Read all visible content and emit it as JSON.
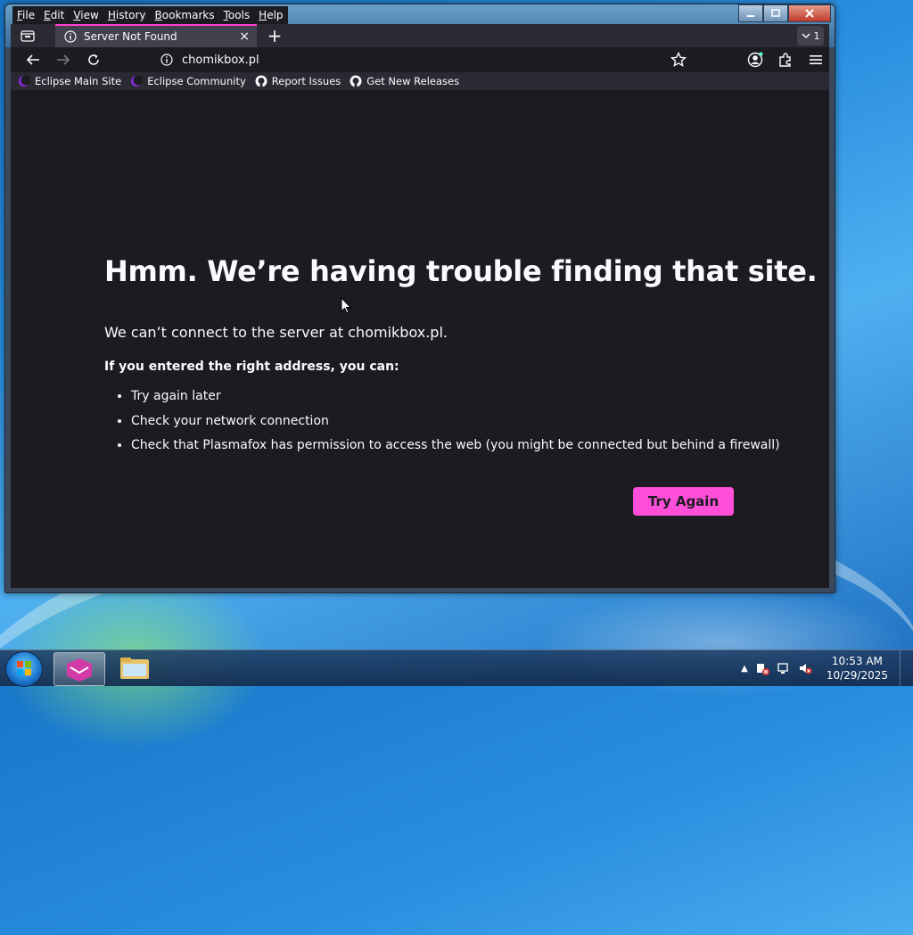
{
  "menu": {
    "items": [
      "File",
      "Edit",
      "View",
      "History",
      "Bookmarks",
      "Tools",
      "Help"
    ]
  },
  "tab": {
    "title": "Server Not Found",
    "close": "×",
    "count": "1"
  },
  "newtab_label": "+",
  "urlbar": {
    "url": "chomikbox.pl"
  },
  "bookmarks": [
    {
      "label": "Eclipse Main Site",
      "icon": "eclipse-icon"
    },
    {
      "label": "Eclipse Community",
      "icon": "eclipse-icon"
    },
    {
      "label": "Report Issues",
      "icon": "github-icon"
    },
    {
      "label": "Get New Releases",
      "icon": "github-icon"
    }
  ],
  "error": {
    "title": "Hmm. We’re having trouble finding that site.",
    "subtitle": "We can’t connect to the server at chomikbox.pl.",
    "lead": "If you entered the right address, you can:",
    "items": [
      "Try again later",
      "Check your network connection",
      "Check that Plasmafox has permission to access the web (you might be connected but behind a firewall)"
    ],
    "button": "Try Again"
  },
  "taskbar": {
    "time": "10:53 AM",
    "date": "10/29/2025"
  },
  "colors": {
    "accent": "#ff4fd8",
    "page_bg": "#1c1b22",
    "toolbar_bg": "#2b2a33"
  }
}
